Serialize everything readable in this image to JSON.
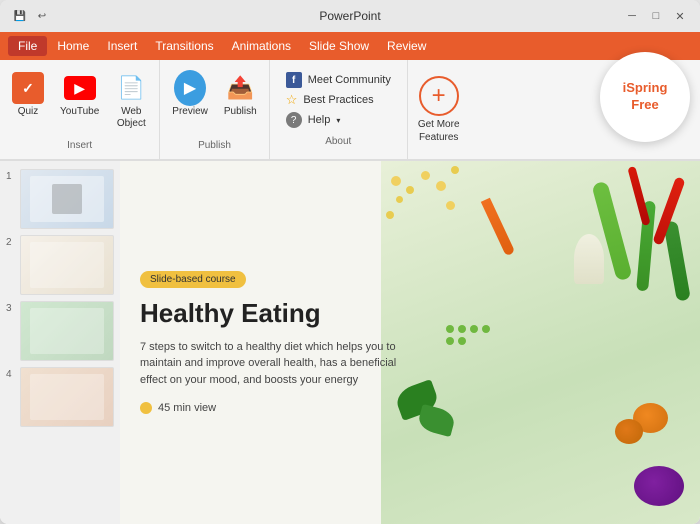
{
  "window": {
    "title": "PowerPoint",
    "controls": {
      "minimize": "─",
      "maximize": "□",
      "close": "✕"
    }
  },
  "menu_bar": {
    "file": "File",
    "home": "Home",
    "insert": "Insert",
    "transitions": "Transitions",
    "animations": "Animations",
    "slideshow": "Slide Show",
    "review": "Review"
  },
  "toolbar": {
    "insert_section": {
      "label": "Insert",
      "quiz_label": "Quiz",
      "youtube_label": "YouTube",
      "web_label": "Web\nObject"
    },
    "publish_section": {
      "label": "Publish",
      "preview_label": "Preview",
      "publish_label": "Publish"
    },
    "about_section": {
      "label": "About",
      "community": "Meet Community",
      "best_practices": "Best Practices",
      "help": "Help"
    },
    "get_more": {
      "line1": "Get More",
      "line2": "Features"
    },
    "ispring": {
      "line1": "iSpring",
      "line2": "Free"
    }
  },
  "slides": [
    {
      "num": "1"
    },
    {
      "num": "2"
    },
    {
      "num": "3"
    },
    {
      "num": "4"
    }
  ],
  "main_slide": {
    "badge": "Slide-based course",
    "title": "Healthy Eating",
    "description": "7 steps to switch to a healthy diet which helps you to maintain and improve overall health, has a beneficial effect on your mood, and boosts your energy",
    "meta": "45 min view"
  }
}
